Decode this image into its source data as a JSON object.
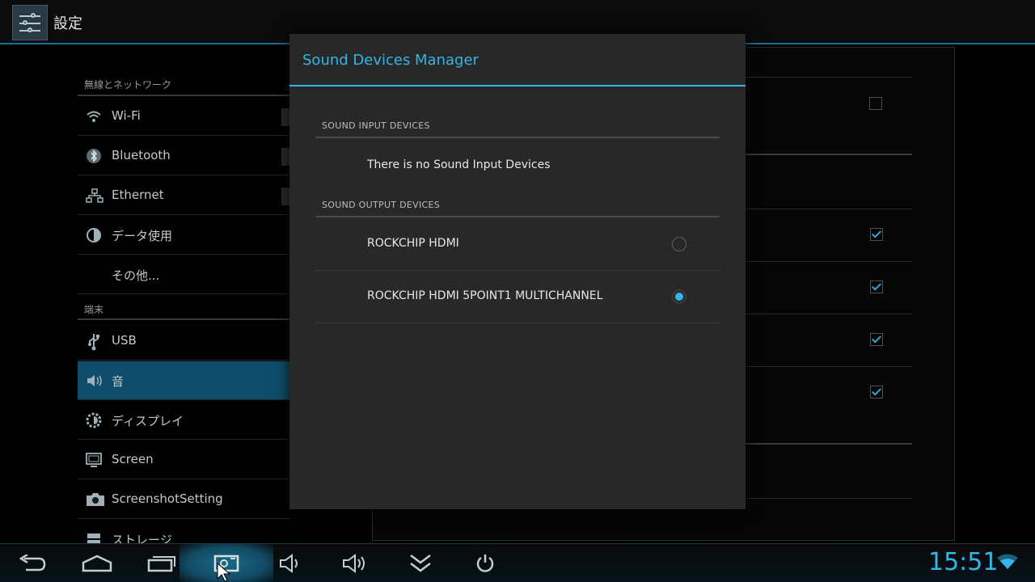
{
  "app": {
    "title": "設定"
  },
  "settings": {
    "section_wireless": "無線とネットワーク",
    "section_device": "端末",
    "items": [
      {
        "label": "Wi-Fi",
        "icon": "wifi-icon"
      },
      {
        "label": "Bluetooth",
        "icon": "bluetooth-icon"
      },
      {
        "label": "Ethernet",
        "icon": "ethernet-icon"
      },
      {
        "label": "データ使用",
        "icon": "data-usage-icon"
      },
      {
        "label": "その他...",
        "icon": ""
      },
      {
        "label": "USB",
        "icon": "usb-icon"
      },
      {
        "label": "音",
        "icon": "speaker-icon",
        "selected": true
      },
      {
        "label": "ディスプレイ",
        "icon": "brightness-icon"
      },
      {
        "label": "Screen",
        "icon": "monitor-icon"
      },
      {
        "label": "ScreenshotSetting",
        "icon": "camera-icon"
      },
      {
        "label": "ストレージ",
        "icon": "storage-icon"
      }
    ]
  },
  "dialog": {
    "title": "Sound Devices Manager",
    "input_header": "SOUND INPUT DEVICES",
    "input_empty": "There is no Sound Input Devices",
    "output_header": "SOUND OUTPUT DEVICES",
    "outputs": [
      {
        "label": "ROCKCHIP HDMI",
        "selected": false
      },
      {
        "label": "ROCKCHIP HDMI 5POINT1 MULTICHANNEL",
        "selected": true
      }
    ]
  },
  "detail": {
    "checkboxes": [
      false,
      true,
      true,
      true,
      true
    ]
  },
  "status": {
    "time": "15:51"
  },
  "colors": {
    "accent": "#33b5e5",
    "selected_bg": "#0e4e6a"
  }
}
